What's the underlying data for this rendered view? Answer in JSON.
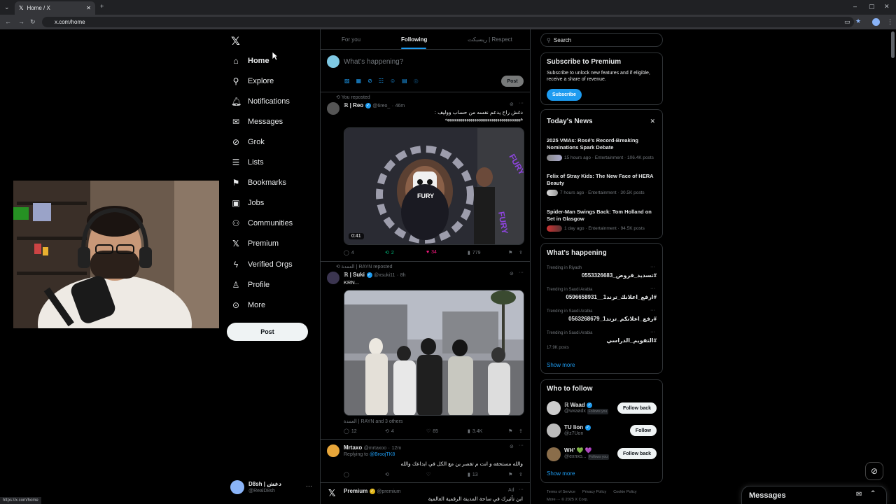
{
  "browser": {
    "tab_title": "Home / X",
    "url": "x.com/home",
    "status_url": "https://x.com/home"
  },
  "nav": {
    "items": [
      {
        "label": "Home",
        "icon": "home-icon"
      },
      {
        "label": "Explore",
        "icon": "search-icon"
      },
      {
        "label": "Notifications",
        "icon": "bell-icon"
      },
      {
        "label": "Messages",
        "icon": "mail-icon"
      },
      {
        "label": "Grok",
        "icon": "grok-icon"
      },
      {
        "label": "Lists",
        "icon": "list-icon"
      },
      {
        "label": "Bookmarks",
        "icon": "bookmark-icon"
      },
      {
        "label": "Jobs",
        "icon": "briefcase-icon"
      },
      {
        "label": "Communities",
        "icon": "people-icon"
      },
      {
        "label": "Premium",
        "icon": "x-logo-icon"
      },
      {
        "label": "Verified Orgs",
        "icon": "lightning-icon"
      },
      {
        "label": "Profile",
        "icon": "person-icon"
      },
      {
        "label": "More",
        "icon": "more-circle-icon"
      }
    ],
    "post_label": "Post",
    "account": {
      "name": "D8sh | دغش",
      "handle": "@RealD8sh"
    }
  },
  "feed": {
    "tabs": [
      "For you",
      "Following",
      "ريسبكت | Respect"
    ],
    "composer_placeholder": "What's happening?",
    "composer_post": "Post",
    "tweets": [
      {
        "context": "You reposted",
        "name": "ℝ | Reo",
        "handle": "@6reo_",
        "time": "46m",
        "text": "دغش راح يدعم نفسه من حساب ووليف :",
        "text2": "هههههههههههههههههههههههههههههههههههههههه",
        "video_time": "0:41",
        "video_caption": "FURY",
        "replies": "4",
        "reposts": "2",
        "likes": "34",
        "views": "779"
      },
      {
        "context": "العمدة | RAYN reposted",
        "name": "ℝ | Suki",
        "handle": "@xsuki11",
        "time": "8h",
        "text": "KRN...",
        "tagline": "العمدة | RAYN and 3 others",
        "replies": "12",
        "reposts": "4",
        "likes": "85",
        "views": "3.4K"
      },
      {
        "name": "Mrtaxo",
        "handle": "@mrtaxoo",
        "time": "12m",
        "replying_prefix": "Replying to",
        "replying_to": "@BroojTK8",
        "text": "والله مستحقه و انت م تقصر بن مع الكل في ابداعك والله",
        "views": "13"
      },
      {
        "name": "Premium",
        "handle": "@premium",
        "ad": "Ad",
        "text": "ابن تأثيرك في ساحة المدينة الرقمية العالمية"
      }
    ]
  },
  "right": {
    "search_placeholder": "Search",
    "premium": {
      "title": "Subscribe to Premium",
      "body": "Subscribe to unlock new features and if eligible, receive a share of revenue.",
      "button": "Subscribe"
    },
    "news": {
      "title": "Today's News",
      "items": [
        {
          "title": "2025 VMAs: Rosé's Record-Breaking Nominations Spark Debate",
          "meta": "15 hours ago · Entertainment · 106.4K posts"
        },
        {
          "title": "Felix of Stray Kids: The New Face of HERA Beauty",
          "meta": "7 hours ago · Entertainment · 30.5K posts"
        },
        {
          "title": "Spider-Man Swings Back: Tom Holland on Set in Glasgow",
          "meta": "1 day ago · Entertainment · 94.5K posts"
        }
      ]
    },
    "happening": {
      "title": "What's happening",
      "items": [
        {
          "context": "Trending in Riyadh",
          "name": "#تسديد_قروض_0553326683",
          "posts": ""
        },
        {
          "context": "Trending in Saudi Arabia",
          "name": "#ارفع_اعلانك_ترند1__0596658931",
          "posts": ""
        },
        {
          "context": "Trending in Saudi Arabia",
          "name": "#رفع_اعلانكم_ترند1_0563268679",
          "posts": ""
        },
        {
          "context": "Trending in Saudi Arabia",
          "name": "#التقويم_الدراسي",
          "posts": "17.9K posts"
        }
      ],
      "show_more": "Show more"
    },
    "follow": {
      "title": "Who to follow",
      "items": [
        {
          "name": "ℝ Waad",
          "handle": "@wxaadx",
          "follows_you": "Follows you",
          "button": "Follow back"
        },
        {
          "name": "TU lion",
          "handle": "@z7Uon",
          "follows_you": "",
          "button": "Follow"
        },
        {
          "name": "WH' 💚 💜",
          "handle": "@exnxo...",
          "follows_you": "Follows you",
          "button": "Follow back"
        }
      ],
      "show_more": "Show more"
    },
    "footer": [
      "Terms of Service",
      "Privacy Policy",
      "Cookie Policy"
    ],
    "footer2": "More ··· © 2025 X Corp."
  },
  "messages_drawer": {
    "label": "Messages"
  },
  "colors": {
    "accent": "#1d9bf0",
    "like": "#f91880",
    "repost": "#00ba7c",
    "border": "#2f3336"
  }
}
